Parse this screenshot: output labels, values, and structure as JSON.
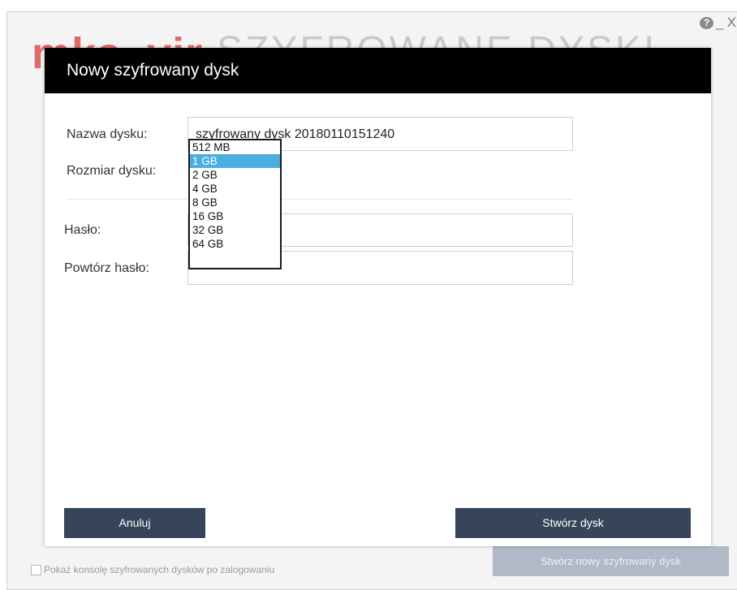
{
  "background": {
    "logo_text": "mks_vir",
    "title": "SZYFROWANE DYSKI",
    "window_controls": {
      "help": "?",
      "minimize": "_",
      "close": "X"
    },
    "footer_checkbox_label": "Pokaż konsolę szyfrowanych dysków po zalogowaniu",
    "create_new_button_label": "Stwórz nowy szyfrowany dysk"
  },
  "dialog": {
    "title": "Nowy szyfrowany dysk",
    "name_label": "Nazwa dysku:",
    "name_value": "szyfrowany dysk 20180110151240",
    "size_label": "Rozmiar dysku:",
    "password_label": "Hasło:",
    "repeat_password_label": "Powtórz hasło:",
    "size_options": [
      "512 MB",
      "1 GB",
      "2 GB",
      "4 GB",
      "8 GB",
      "16 GB",
      "32 GB",
      "64 GB"
    ],
    "size_selected": "1 GB",
    "cancel_label": "Anuluj",
    "create_label": "Stwórz dysk"
  },
  "colors": {
    "header_bg": "#000000",
    "button_bg": "#37445a",
    "selected_option_bg": "#4aaee0",
    "disabled_button_bg": "#b0b9c6"
  }
}
